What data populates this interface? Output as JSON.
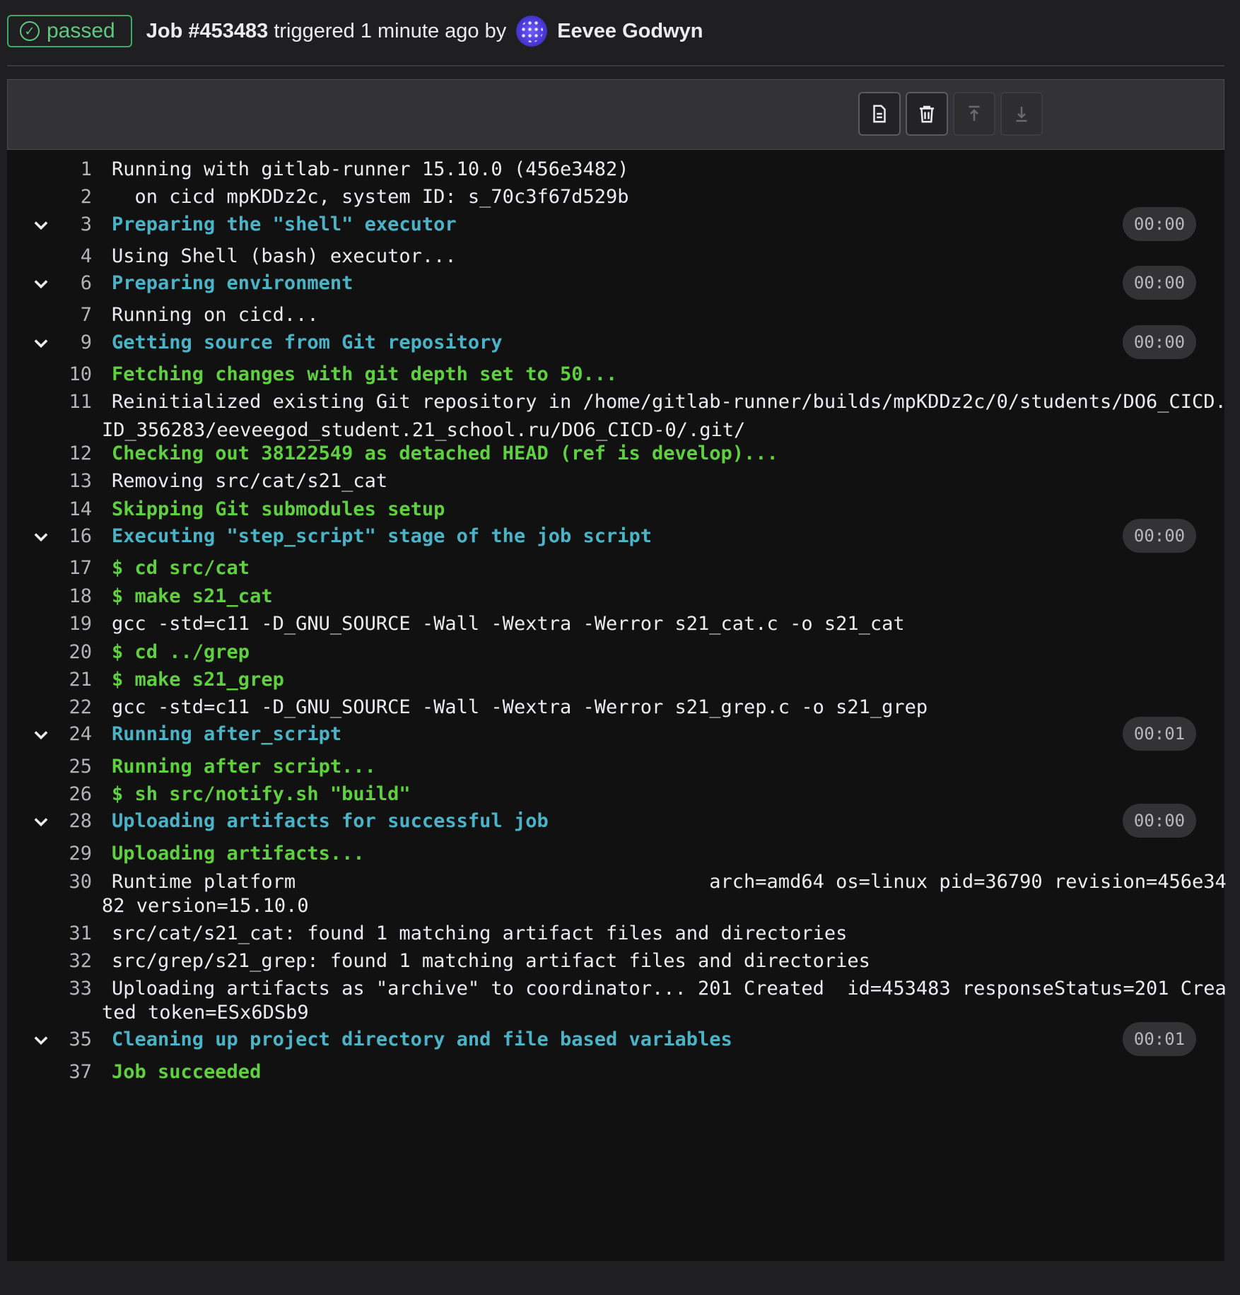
{
  "header": {
    "status": "passed",
    "job_title": "Job #453483",
    "triggered_text": "triggered 1 minute ago by",
    "user_name": "Eevee Godwyn"
  },
  "toolbar": {
    "buttons": [
      "show-raw-icon",
      "erase-log-icon",
      "scroll-to-top-icon",
      "scroll-to-bottom-icon"
    ]
  },
  "colors": {
    "section_header": "#4cb3c7",
    "success_text": "#5fd03f",
    "status_passed": "#3fa86b",
    "log_bg": "#111112"
  },
  "log": {
    "l1": "Running with gitlab-runner 15.10.0 (456e3482)",
    "l2": "  on cicd mpKDDz2c, system ID: s_70c3f67d529b",
    "l3": "Preparing the \"shell\" executor",
    "l3_dur": "00:00",
    "l4": "Using Shell (bash) executor...",
    "l6": "Preparing environment",
    "l6_dur": "00:00",
    "l7": "Running on cicd...",
    "l9": "Getting source from Git repository",
    "l9_dur": "00:00",
    "l10": "Fetching changes with git depth set to 50...",
    "l11a": "Reinitialized existing Git repository in /home/gitlab-runner/builds/mpKDDz2c/0/students/DO6_CICD.",
    "l11b": "ID_356283/eeveegod_student.21_school.ru/DO6_CICD-0/.git/",
    "l12": "Checking out 38122549 as detached HEAD (ref is develop)...",
    "l13": "Removing src/cat/s21_cat",
    "l14": "Skipping Git submodules setup",
    "l16": "Executing \"step_script\" stage of the job script",
    "l16_dur": "00:00",
    "l17": "$ cd src/cat",
    "l18": "$ make s21_cat",
    "l19": "gcc -std=c11 -D_GNU_SOURCE -Wall -Wextra -Werror s21_cat.c -o s21_cat",
    "l20": "$ cd ../grep",
    "l21": "$ make s21_grep",
    "l22": "gcc -std=c11 -D_GNU_SOURCE -Wall -Wextra -Werror s21_grep.c -o s21_grep",
    "l24": "Running after_script",
    "l24_dur": "00:01",
    "l25": "Running after script...",
    "l26": "$ sh src/notify.sh \"build\"",
    "l28": "Uploading artifacts for successful job",
    "l28_dur": "00:00",
    "l29": "Uploading artifacts...",
    "l30a": "Runtime platform                                    arch=amd64 os=linux pid=36790 revision=456e34",
    "l30b": "82 version=15.10.0",
    "l31": "src/cat/s21_cat: found 1 matching artifact files and directories",
    "l32": "src/grep/s21_grep: found 1 matching artifact files and directories",
    "l33a": "Uploading artifacts as \"archive\" to coordinator... 201 Created  id=453483 responseStatus=201 Crea",
    "l33b": "ted token=ESx6DSb9",
    "l35": "Cleaning up project directory and file based variables",
    "l35_dur": "00:01",
    "l37": "Job succeeded",
    "n": {
      "n1": "1",
      "n2": "2",
      "n3": "3",
      "n4": "4",
      "n6": "6",
      "n7": "7",
      "n9": "9",
      "n10": "10",
      "n11": "11",
      "n12": "12",
      "n13": "13",
      "n14": "14",
      "n16": "16",
      "n17": "17",
      "n18": "18",
      "n19": "19",
      "n20": "20",
      "n21": "21",
      "n22": "22",
      "n24": "24",
      "n25": "25",
      "n26": "26",
      "n28": "28",
      "n29": "29",
      "n30": "30",
      "n31": "31",
      "n32": "32",
      "n33": "33",
      "n35": "35",
      "n37": "37"
    }
  }
}
